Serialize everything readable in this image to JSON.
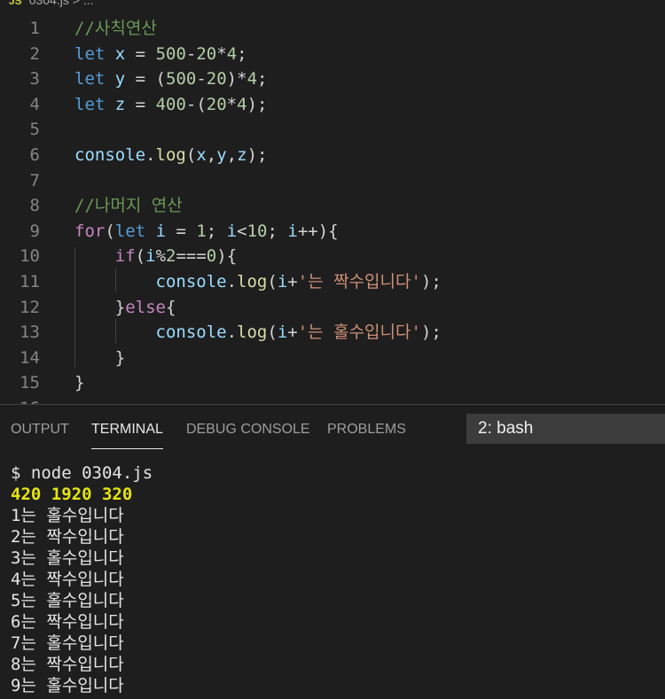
{
  "breadcrumb": {
    "badge": "JS",
    "path": "0304.js > ..."
  },
  "editor": {
    "lines": [
      {
        "n": "1",
        "tokens": [
          {
            "t": "//사칙연산",
            "c": "comment"
          }
        ]
      },
      {
        "n": "2",
        "tokens": [
          {
            "t": "let",
            "c": "keyword"
          },
          {
            "t": " ",
            "c": "plain"
          },
          {
            "t": "x",
            "c": "var"
          },
          {
            "t": " = ",
            "c": "plain"
          },
          {
            "t": "500",
            "c": "number"
          },
          {
            "t": "-",
            "c": "plain"
          },
          {
            "t": "20",
            "c": "number"
          },
          {
            "t": "*",
            "c": "plain"
          },
          {
            "t": "4",
            "c": "number"
          },
          {
            "t": ";",
            "c": "plain"
          }
        ]
      },
      {
        "n": "3",
        "tokens": [
          {
            "t": "let",
            "c": "keyword"
          },
          {
            "t": " ",
            "c": "plain"
          },
          {
            "t": "y",
            "c": "var"
          },
          {
            "t": " = (",
            "c": "plain"
          },
          {
            "t": "500",
            "c": "number"
          },
          {
            "t": "-",
            "c": "plain"
          },
          {
            "t": "20",
            "c": "number"
          },
          {
            "t": ")*",
            "c": "plain"
          },
          {
            "t": "4",
            "c": "number"
          },
          {
            "t": ";",
            "c": "plain"
          }
        ]
      },
      {
        "n": "4",
        "tokens": [
          {
            "t": "let",
            "c": "keyword"
          },
          {
            "t": " ",
            "c": "plain"
          },
          {
            "t": "z",
            "c": "var"
          },
          {
            "t": " = ",
            "c": "plain"
          },
          {
            "t": "400",
            "c": "number"
          },
          {
            "t": "-(",
            "c": "plain"
          },
          {
            "t": "20",
            "c": "number"
          },
          {
            "t": "*",
            "c": "plain"
          },
          {
            "t": "4",
            "c": "number"
          },
          {
            "t": ");",
            "c": "plain"
          }
        ]
      },
      {
        "n": "5",
        "tokens": []
      },
      {
        "n": "6",
        "tokens": [
          {
            "t": "console",
            "c": "var"
          },
          {
            "t": ".",
            "c": "plain"
          },
          {
            "t": "log",
            "c": "func"
          },
          {
            "t": "(",
            "c": "plain"
          },
          {
            "t": "x",
            "c": "var"
          },
          {
            "t": ",",
            "c": "plain"
          },
          {
            "t": "y",
            "c": "var"
          },
          {
            "t": ",",
            "c": "plain"
          },
          {
            "t": "z",
            "c": "var"
          },
          {
            "t": ");",
            "c": "plain"
          }
        ]
      },
      {
        "n": "7",
        "tokens": []
      },
      {
        "n": "8",
        "tokens": [
          {
            "t": "//나머지 연산",
            "c": "comment"
          }
        ]
      },
      {
        "n": "9",
        "tokens": [
          {
            "t": "for",
            "c": "control"
          },
          {
            "t": "(",
            "c": "plain"
          },
          {
            "t": "let",
            "c": "keyword"
          },
          {
            "t": " ",
            "c": "plain"
          },
          {
            "t": "i",
            "c": "var"
          },
          {
            "t": " = ",
            "c": "plain"
          },
          {
            "t": "1",
            "c": "number"
          },
          {
            "t": "; ",
            "c": "plain"
          },
          {
            "t": "i",
            "c": "var"
          },
          {
            "t": "<",
            "c": "plain"
          },
          {
            "t": "10",
            "c": "number"
          },
          {
            "t": "; ",
            "c": "plain"
          },
          {
            "t": "i",
            "c": "var"
          },
          {
            "t": "++){",
            "c": "plain"
          }
        ]
      },
      {
        "n": "10",
        "tokens": [
          {
            "t": "    ",
            "c": "plain"
          },
          {
            "t": "if",
            "c": "control"
          },
          {
            "t": "(",
            "c": "plain"
          },
          {
            "t": "i",
            "c": "var"
          },
          {
            "t": "%",
            "c": "plain"
          },
          {
            "t": "2",
            "c": "number"
          },
          {
            "t": "===",
            "c": "plain"
          },
          {
            "t": "0",
            "c": "number"
          },
          {
            "t": "){",
            "c": "plain"
          }
        ]
      },
      {
        "n": "11",
        "tokens": [
          {
            "t": "        ",
            "c": "plain"
          },
          {
            "t": "console",
            "c": "var"
          },
          {
            "t": ".",
            "c": "plain"
          },
          {
            "t": "log",
            "c": "func"
          },
          {
            "t": "(",
            "c": "plain"
          },
          {
            "t": "i",
            "c": "var"
          },
          {
            "t": "+",
            "c": "plain"
          },
          {
            "t": "'는 짝수입니다'",
            "c": "string"
          },
          {
            "t": ");",
            "c": "plain"
          }
        ]
      },
      {
        "n": "12",
        "tokens": [
          {
            "t": "    }",
            "c": "plain"
          },
          {
            "t": "else",
            "c": "control"
          },
          {
            "t": "{",
            "c": "plain"
          }
        ]
      },
      {
        "n": "13",
        "tokens": [
          {
            "t": "        ",
            "c": "plain"
          },
          {
            "t": "console",
            "c": "var"
          },
          {
            "t": ".",
            "c": "plain"
          },
          {
            "t": "log",
            "c": "func"
          },
          {
            "t": "(",
            "c": "plain"
          },
          {
            "t": "i",
            "c": "var"
          },
          {
            "t": "+",
            "c": "plain"
          },
          {
            "t": "'는 홀수입니다'",
            "c": "string"
          },
          {
            "t": ");",
            "c": "plain"
          }
        ]
      },
      {
        "n": "14",
        "tokens": [
          {
            "t": "    }",
            "c": "plain"
          }
        ]
      },
      {
        "n": "15",
        "tokens": [
          {
            "t": "}",
            "c": "plain"
          }
        ]
      },
      {
        "n": "16",
        "tokens": []
      }
    ]
  },
  "panel": {
    "tabs": [
      {
        "id": "output",
        "label": "OUTPUT",
        "active": false
      },
      {
        "id": "terminal",
        "label": "TERMINAL",
        "active": true
      },
      {
        "id": "debug-console",
        "label": "DEBUG CONSOLE",
        "active": false
      },
      {
        "id": "problems",
        "label": "PROBLEMS",
        "active": false
      }
    ],
    "terminal_selector": "2: bash",
    "terminal_lines": [
      {
        "text": "$ node 0304.js",
        "style": "plain"
      },
      {
        "text": "420 1920 320",
        "style": "yellow"
      },
      {
        "text": "1는 홀수입니다",
        "style": "plain"
      },
      {
        "text": "2는 짝수입니다",
        "style": "plain"
      },
      {
        "text": "3는 홀수입니다",
        "style": "plain"
      },
      {
        "text": "4는 짝수입니다",
        "style": "plain"
      },
      {
        "text": "5는 홀수입니다",
        "style": "plain"
      },
      {
        "text": "6는 짝수입니다",
        "style": "plain"
      },
      {
        "text": "7는 홀수입니다",
        "style": "plain"
      },
      {
        "text": "8는 짝수입니다",
        "style": "plain"
      },
      {
        "text": "9는 홀수입니다",
        "style": "plain"
      }
    ]
  }
}
